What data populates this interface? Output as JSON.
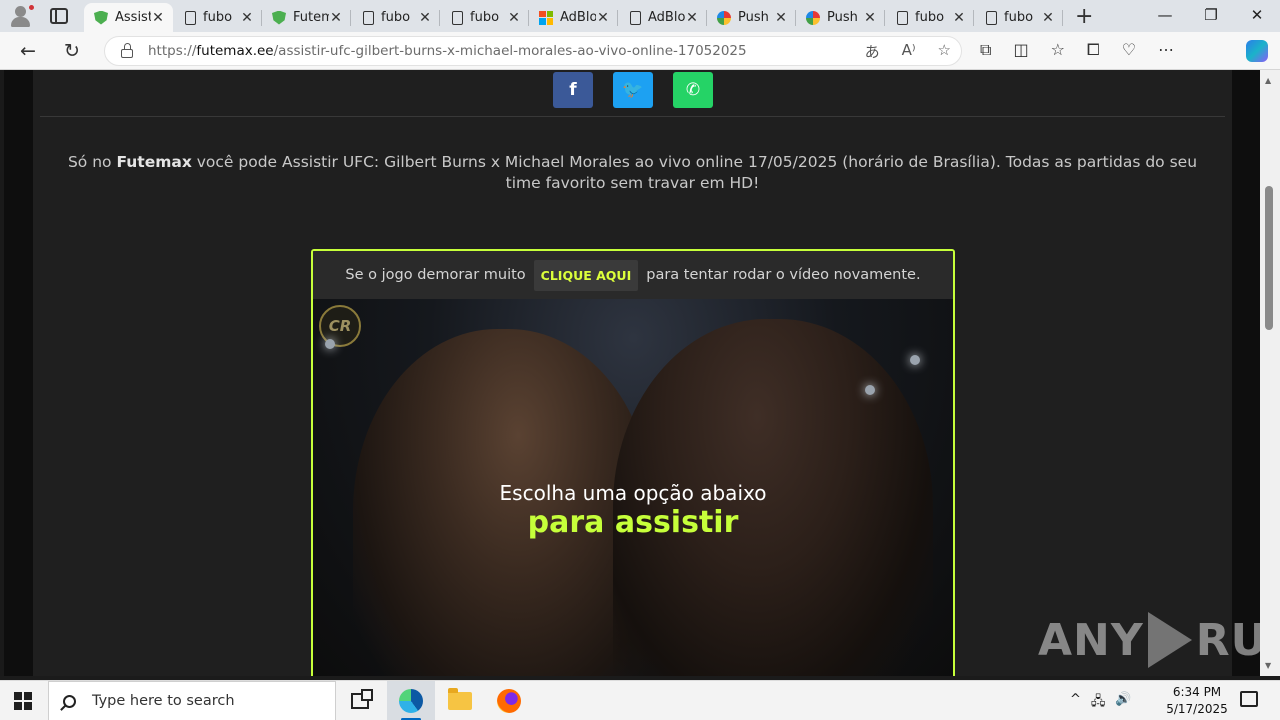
{
  "browser": {
    "tabs": [
      {
        "label": "Assistir",
        "favicon": "shield-icon",
        "active": true
      },
      {
        "label": "fubo",
        "favicon": "document-icon",
        "active": false
      },
      {
        "label": "Futemax",
        "favicon": "shield-icon",
        "active": false
      },
      {
        "label": "fubo",
        "favicon": "document-icon",
        "active": false
      },
      {
        "label": "fubo",
        "favicon": "document-icon",
        "active": false
      },
      {
        "label": "AdBlock",
        "favicon": "microsoft-icon",
        "active": false
      },
      {
        "label": "AdBlock",
        "favicon": "document-icon",
        "active": false
      },
      {
        "label": "Push",
        "favicon": "push-icon",
        "active": false
      },
      {
        "label": "Push",
        "favicon": "push-icon",
        "active": false
      },
      {
        "label": "fubo",
        "favicon": "document-icon",
        "active": false
      },
      {
        "label": "fubo",
        "favicon": "document-icon",
        "active": false
      }
    ],
    "close_glyph": "✕",
    "new_tab_glyph": "+",
    "window_controls": {
      "minimize": "—",
      "restore": "❐",
      "close": "✕"
    },
    "address": {
      "scheme": "https://",
      "host": "futemax.ee",
      "path": "/assistir-ufc-gilbert-burns-x-michael-morales-ao-vivo-online-17052025"
    },
    "nav": {
      "back": "←",
      "reload": "↻"
    },
    "omni_icons": {
      "translate": "あ",
      "read_aloud": "A⁾",
      "favorite": "☆"
    },
    "toolbar_icons": {
      "extensions": "⧉",
      "split": "◫",
      "favorites": "☆",
      "collections": "⧠",
      "performance": "♡",
      "menu": "⋯"
    }
  },
  "page": {
    "share": {
      "facebook": "f",
      "twitter": "🐦",
      "whatsapp": "✆"
    },
    "intro": {
      "prefix": "Só no ",
      "brand": "Futemax",
      "text": " você pode Assistir UFC: Gilbert Burns x Michael Morales ao vivo online 17/05/2025 (horário de Brasília). Todas as partidas do seu time favorito sem travar em HD!"
    },
    "player": {
      "notice_before": "Se o jogo demorar muito",
      "cta": "CLIQUE AQUI",
      "notice_after": "para tentar rodar o vídeo novamente.",
      "overlay_line1": "Escolha uma opção abaixo",
      "overlay_line2": "para assistir",
      "logo_text": "CR"
    },
    "watermark": {
      "left": "ANY",
      "right": "RUN"
    }
  },
  "taskbar": {
    "search_placeholder": "Type here to search",
    "time": "6:34 PM",
    "date": "5/17/2025",
    "tray": {
      "chevron": "^",
      "network": "🖧",
      "volume": "🔊"
    }
  },
  "colors": {
    "accent": "#c6ff3a",
    "facebook": "#3b5998",
    "twitter": "#1da1f2",
    "whatsapp": "#25d366"
  }
}
